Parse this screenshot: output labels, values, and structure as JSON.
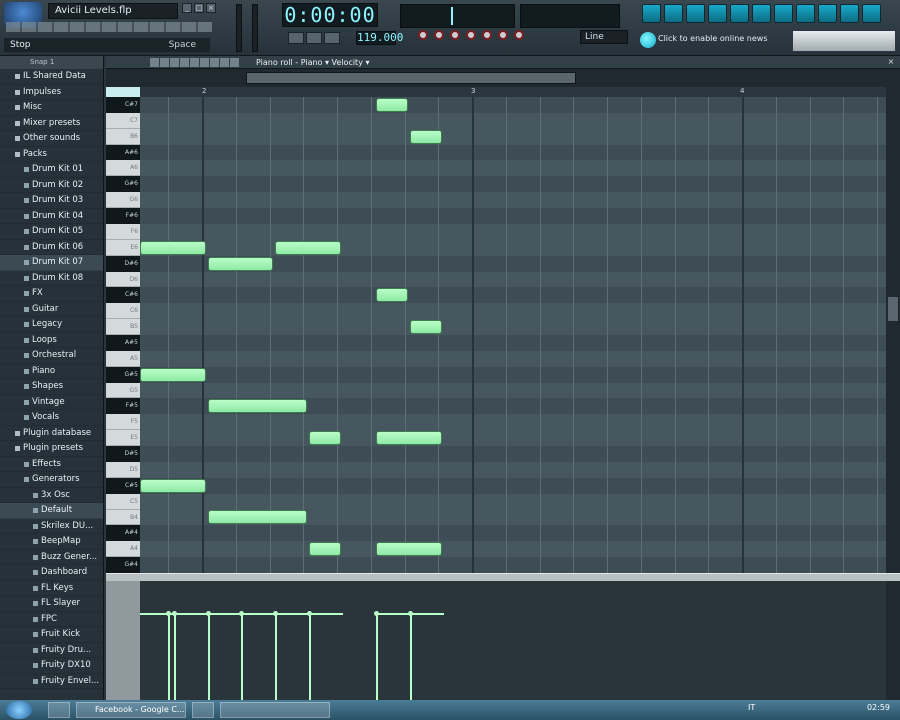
{
  "window": {
    "project_title": "Avicii Levels.flp",
    "hint_text": "Stop",
    "hint_right": "Space"
  },
  "transport": {
    "time": "0:00:00",
    "tempo": "119.000",
    "line_mode": "Line",
    "news": "Click to enable online news"
  },
  "browser": {
    "header": "Snap 1",
    "items": [
      {
        "label": "IL Shared Data",
        "indent": 1,
        "folder": true
      },
      {
        "label": "Impulses",
        "indent": 1,
        "folder": true
      },
      {
        "label": "Misc",
        "indent": 1,
        "folder": true
      },
      {
        "label": "Mixer presets",
        "indent": 1,
        "folder": true
      },
      {
        "label": "Other sounds",
        "indent": 1,
        "folder": true
      },
      {
        "label": "Packs",
        "indent": 1,
        "folder": true
      },
      {
        "label": "Drum Kit 01",
        "indent": 2
      },
      {
        "label": "Drum Kit 02",
        "indent": 2
      },
      {
        "label": "Drum Kit 03",
        "indent": 2
      },
      {
        "label": "Drum Kit 04",
        "indent": 2
      },
      {
        "label": "Drum Kit 05",
        "indent": 2
      },
      {
        "label": "Drum Kit 06",
        "indent": 2
      },
      {
        "label": "Drum Kit 07",
        "indent": 2,
        "selected": true
      },
      {
        "label": "Drum Kit 08",
        "indent": 2
      },
      {
        "label": "FX",
        "indent": 2
      },
      {
        "label": "Guitar",
        "indent": 2
      },
      {
        "label": "Legacy",
        "indent": 2
      },
      {
        "label": "Loops",
        "indent": 2
      },
      {
        "label": "Orchestral",
        "indent": 2
      },
      {
        "label": "Piano",
        "indent": 2
      },
      {
        "label": "Shapes",
        "indent": 2
      },
      {
        "label": "Vintage",
        "indent": 2
      },
      {
        "label": "Vocals",
        "indent": 2
      },
      {
        "label": "Plugin database",
        "indent": 1,
        "folder": true
      },
      {
        "label": "Plugin presets",
        "indent": 1,
        "folder": true
      },
      {
        "label": "Effects",
        "indent": 2
      },
      {
        "label": "Generators",
        "indent": 2
      },
      {
        "label": "3x Osc",
        "indent": 3
      },
      {
        "label": "Default",
        "indent": 3,
        "selected": true
      },
      {
        "label": "Skrilex DU...",
        "indent": 3
      },
      {
        "label": "BeepMap",
        "indent": 3
      },
      {
        "label": "Buzz Gener...",
        "indent": 3
      },
      {
        "label": "Dashboard",
        "indent": 3
      },
      {
        "label": "FL Keys",
        "indent": 3
      },
      {
        "label": "FL Slayer",
        "indent": 3
      },
      {
        "label": "FPC",
        "indent": 3
      },
      {
        "label": "Fruit Kick",
        "indent": 3
      },
      {
        "label": "Fruity Dru...",
        "indent": 3
      },
      {
        "label": "Fruity DX10",
        "indent": 3
      },
      {
        "label": "Fruity Envel...",
        "indent": 3
      }
    ]
  },
  "piano_roll": {
    "breadcrumb": "Piano roll - Piano ▾  Velocity ▾",
    "bar_numbers": [
      "2",
      "3",
      "4"
    ],
    "keys": [
      "C#7",
      "C7",
      "B6",
      "A#6",
      "A6",
      "G#6",
      "G6",
      "F#6",
      "F6",
      "E6",
      "D#6",
      "D6",
      "C#6",
      "C6",
      "B5",
      "A#5",
      "A5",
      "G#5",
      "G5",
      "F#5",
      "F5",
      "E5",
      "D#5",
      "D5",
      "C#5",
      "C5",
      "B4",
      "A#4",
      "A4",
      "G#4"
    ],
    "notes": [
      {
        "key": "C#7",
        "step": 7,
        "len": 1
      },
      {
        "key": "B6",
        "step": 8,
        "len": 1
      },
      {
        "key": "E6",
        "step": 0,
        "len": 2
      },
      {
        "key": "E6",
        "step": 4,
        "len": 2
      },
      {
        "key": "D#6",
        "step": 2,
        "len": 2
      },
      {
        "key": "C#6",
        "step": 7,
        "len": 1
      },
      {
        "key": "B5",
        "step": 8,
        "len": 1
      },
      {
        "key": "G#5",
        "step": 0,
        "len": 2
      },
      {
        "key": "F#5",
        "step": 2,
        "len": 3
      },
      {
        "key": "E5",
        "step": 5,
        "len": 1
      },
      {
        "key": "E5",
        "step": 7,
        "len": 2
      },
      {
        "key": "C#5",
        "step": 0,
        "len": 2
      },
      {
        "key": "B4",
        "step": 2,
        "len": 3
      },
      {
        "key": "A4",
        "step": 5,
        "len": 1
      },
      {
        "key": "A4",
        "step": 7,
        "len": 2
      }
    ],
    "velocity_steps": [
      0,
      1,
      2,
      3,
      4,
      5,
      7,
      8
    ],
    "velocity_level": 0.78
  },
  "taskbar": {
    "items": [
      "",
      "Facebook - Google C...",
      "",
      ""
    ],
    "lang": "IT",
    "clock": "02:59"
  },
  "colors": {
    "note": "#b9ffc8",
    "accent": "#17a7c9"
  }
}
